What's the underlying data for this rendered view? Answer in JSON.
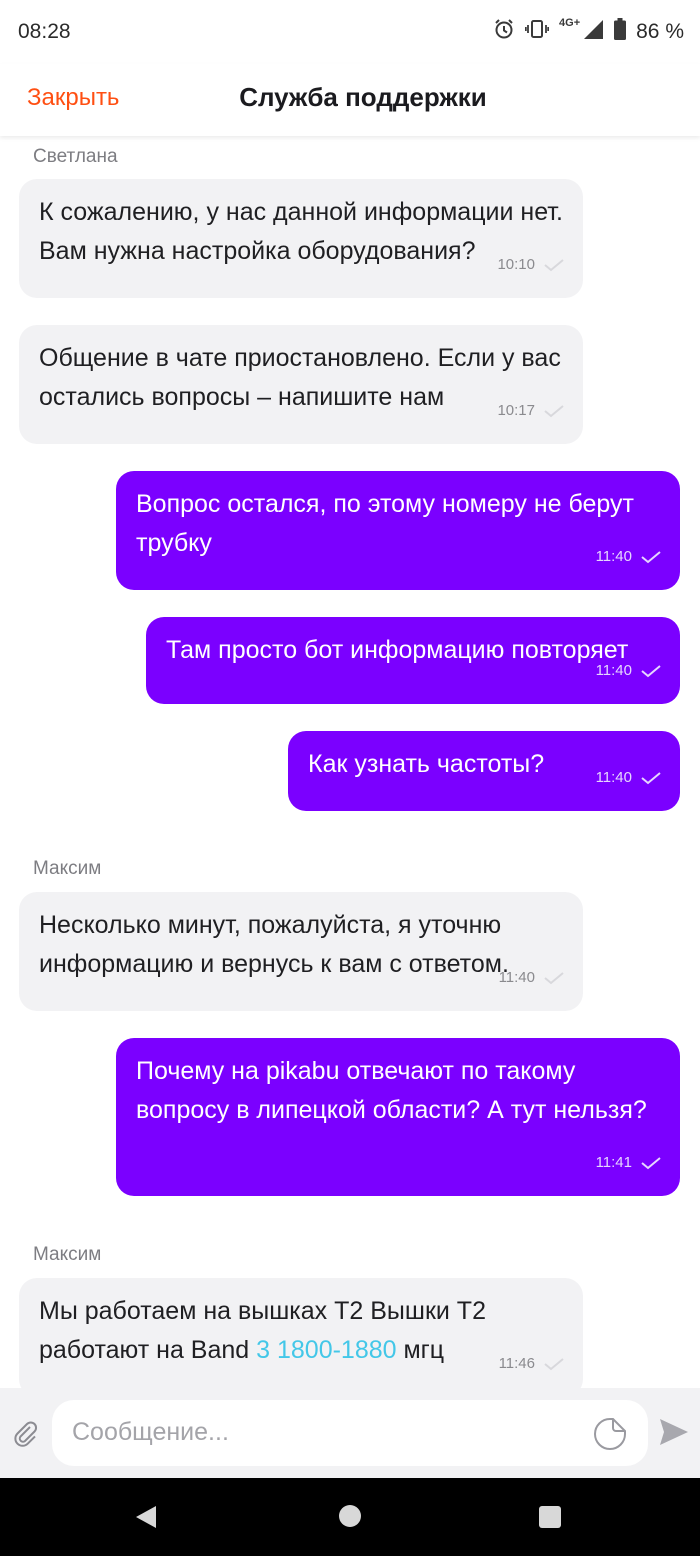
{
  "status_bar": {
    "time": "08:28",
    "network": "4G+",
    "battery": "86 %"
  },
  "header": {
    "close_label": "Закрыть",
    "title": "Служба поддержки"
  },
  "messages": [
    {
      "sender": "Светлана",
      "text": "К сожалению, у нас данной информации нет. Вам нужна настройка оборудования?",
      "time": "10:10"
    },
    {
      "text": "Общение в чате приостановлено. Если у вас остались вопросы – напишите нам",
      "time": "10:17"
    },
    {
      "text": "Вопрос остался, по этому номеру не берут трубку",
      "time": "11:40"
    },
    {
      "text": "Там просто бот информацию повторяет",
      "time": "11:40"
    },
    {
      "text": "Как узнать частоты?",
      "time": "11:40"
    },
    {
      "sender": "Максим",
      "text": "Несколько минут, пожалуйста, я уточню информацию и вернусь к вам с ответом.",
      "time": "11:40"
    },
    {
      "text": "Почему на pikabu отвечают по такому вопросу в липецкой области? А тут нельзя?",
      "time": "11:41"
    },
    {
      "sender": "Максим",
      "text_before": "Мы работаем на вышках Т2 Вышки Т2 работают на Band ",
      "link": "3 1800-1880",
      "text_after": " мгц",
      "time": "11:46"
    }
  ],
  "composer": {
    "placeholder": "Сообщение..."
  },
  "colors": {
    "accent": "#ff4f12",
    "outgoing": "#7b00ff",
    "incoming": "#f2f2f4",
    "link": "#43c7e8"
  }
}
